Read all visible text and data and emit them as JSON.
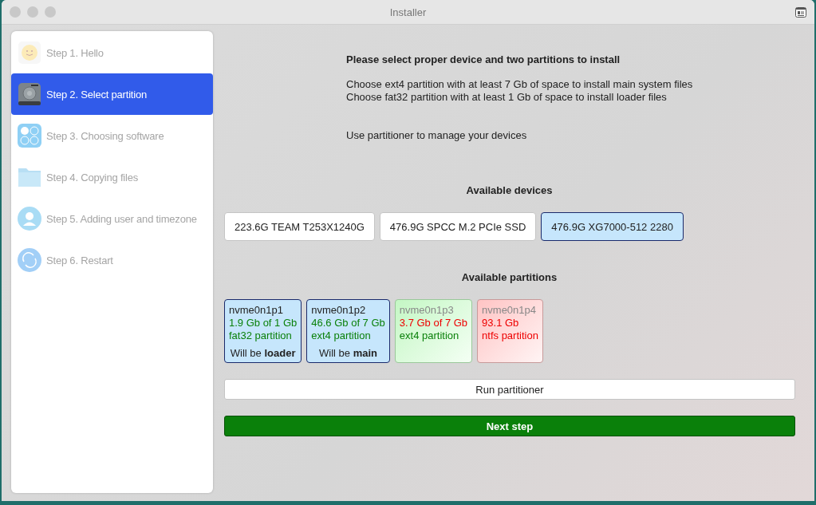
{
  "window": {
    "title": "Installer"
  },
  "sidebar": {
    "items": [
      {
        "label": "Step 1. Hello",
        "kind": "hello",
        "selected": false
      },
      {
        "label": "Step 2. Select partition",
        "kind": "disk",
        "selected": true
      },
      {
        "label": "Step 3. Choosing software",
        "kind": "apps",
        "selected": false
      },
      {
        "label": "Step 4. Copying files",
        "kind": "folder",
        "selected": false
      },
      {
        "label": "Step 5. Adding user and timezone",
        "kind": "user",
        "selected": false
      },
      {
        "label": "Step 6. Restart",
        "kind": "restart",
        "selected": false
      }
    ]
  },
  "intro": {
    "heading": "Please select proper device and two partitions to install",
    "lines": [
      "Choose ext4 partition with at least 7 Gb of space to install main system files",
      "Choose fat32 partition with at least 1 Gb of space to install loader files"
    ],
    "hint": "Use partitioner to manage your devices"
  },
  "devices": {
    "title": "Available devices",
    "items": [
      {
        "label": "223.6G TEAM T253X1240G",
        "selected": false
      },
      {
        "label": "476.9G SPCC M.2 PCIe SSD",
        "selected": false
      },
      {
        "label": "476.9G XG7000-512 2280",
        "selected": true
      }
    ]
  },
  "partitions": {
    "title": "Available partitions",
    "items": [
      {
        "name": "nvme0n1p1",
        "size": "1.9 Gb of 1 Gb",
        "size_fits": true,
        "type": "fat32 partition",
        "type_fits": true,
        "selected": true,
        "role": "Will be **loader**"
      },
      {
        "name": "nvme0n1p2",
        "size": "46.6 Gb of 7 Gb",
        "size_fits": true,
        "type": "ext4 partition",
        "type_fits": true,
        "selected": true,
        "role": "Will be **main**"
      },
      {
        "name": "nvme0n1p3",
        "size": "3.7 Gb of 7 Gb",
        "size_fits": false,
        "type": "ext4 partition",
        "type_fits": true,
        "selected": false
      },
      {
        "name": "nvme0n1p4",
        "size": "93.1 Gb",
        "size_fits": false,
        "type": "ntfs partition",
        "type_fits": false,
        "selected": false
      }
    ]
  },
  "buttons": {
    "partitioner": "Run partitioner",
    "next": "Next step"
  }
}
